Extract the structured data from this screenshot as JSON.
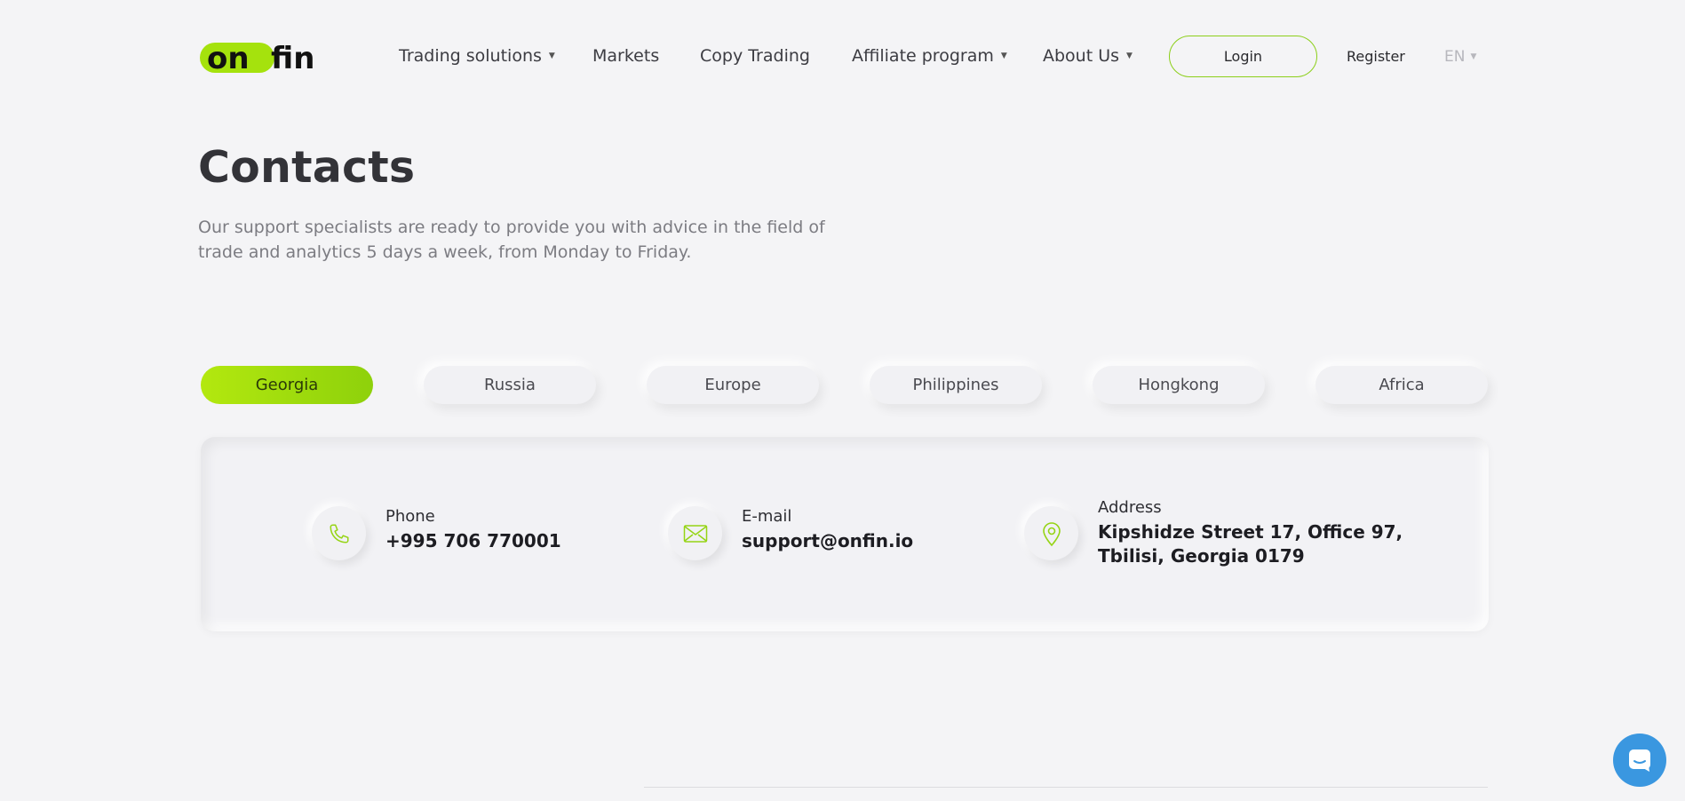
{
  "header": {
    "logo_alt": "onfin",
    "nav": [
      {
        "label": "Trading solutions",
        "has_dropdown": true
      },
      {
        "label": "Markets",
        "has_dropdown": false
      },
      {
        "label": "Copy Trading",
        "has_dropdown": false
      },
      {
        "label": "Affiliate program",
        "has_dropdown": true
      },
      {
        "label": "About Us",
        "has_dropdown": true
      }
    ],
    "login_label": "Login",
    "register_label": "Register",
    "language": "EN"
  },
  "main": {
    "title": "Contacts",
    "intro": "Our support specialists are ready to provide you with advice in the field of trade and analytics 5 days a week, from Monday to Friday.",
    "tabs": [
      {
        "label": "Georgia",
        "active": true
      },
      {
        "label": "Russia",
        "active": false
      },
      {
        "label": "Europe",
        "active": false
      },
      {
        "label": "Philippines",
        "active": false
      },
      {
        "label": "Hongkong",
        "active": false
      },
      {
        "label": "Africa",
        "active": false
      }
    ],
    "contact": {
      "phone": {
        "label": "Phone",
        "value": "+995 706 770001",
        "icon": "phone-icon"
      },
      "email": {
        "label": "E-mail",
        "value": "support@onfin.io",
        "icon": "envelope-icon"
      },
      "address": {
        "label": "Address",
        "line1": "Kipshidze Street 17, Office 97,",
        "line2": "Tbilisi, Georgia 0179",
        "icon": "map-pin-icon"
      }
    }
  },
  "colors": {
    "accent": "#9bdc0c",
    "accent_dark": "#8ed10b",
    "background": "#f4f4f6",
    "chat_button": "#3a97e0"
  }
}
